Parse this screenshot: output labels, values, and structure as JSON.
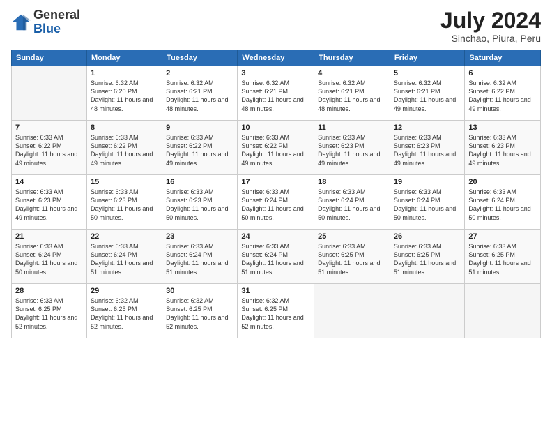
{
  "logo": {
    "general": "General",
    "blue": "Blue"
  },
  "title": {
    "month_year": "July 2024",
    "location": "Sinchao, Piura, Peru"
  },
  "weekdays": [
    "Sunday",
    "Monday",
    "Tuesday",
    "Wednesday",
    "Thursday",
    "Friday",
    "Saturday"
  ],
  "weeks": [
    [
      {
        "day": "",
        "sunrise": "",
        "sunset": "",
        "daylight": ""
      },
      {
        "day": "1",
        "sunrise": "Sunrise: 6:32 AM",
        "sunset": "Sunset: 6:20 PM",
        "daylight": "Daylight: 11 hours and 48 minutes."
      },
      {
        "day": "2",
        "sunrise": "Sunrise: 6:32 AM",
        "sunset": "Sunset: 6:21 PM",
        "daylight": "Daylight: 11 hours and 48 minutes."
      },
      {
        "day": "3",
        "sunrise": "Sunrise: 6:32 AM",
        "sunset": "Sunset: 6:21 PM",
        "daylight": "Daylight: 11 hours and 48 minutes."
      },
      {
        "day": "4",
        "sunrise": "Sunrise: 6:32 AM",
        "sunset": "Sunset: 6:21 PM",
        "daylight": "Daylight: 11 hours and 48 minutes."
      },
      {
        "day": "5",
        "sunrise": "Sunrise: 6:32 AM",
        "sunset": "Sunset: 6:21 PM",
        "daylight": "Daylight: 11 hours and 49 minutes."
      },
      {
        "day": "6",
        "sunrise": "Sunrise: 6:32 AM",
        "sunset": "Sunset: 6:22 PM",
        "daylight": "Daylight: 11 hours and 49 minutes."
      }
    ],
    [
      {
        "day": "7",
        "sunrise": "Sunrise: 6:33 AM",
        "sunset": "Sunset: 6:22 PM",
        "daylight": "Daylight: 11 hours and 49 minutes."
      },
      {
        "day": "8",
        "sunrise": "Sunrise: 6:33 AM",
        "sunset": "Sunset: 6:22 PM",
        "daylight": "Daylight: 11 hours and 49 minutes."
      },
      {
        "day": "9",
        "sunrise": "Sunrise: 6:33 AM",
        "sunset": "Sunset: 6:22 PM",
        "daylight": "Daylight: 11 hours and 49 minutes."
      },
      {
        "day": "10",
        "sunrise": "Sunrise: 6:33 AM",
        "sunset": "Sunset: 6:22 PM",
        "daylight": "Daylight: 11 hours and 49 minutes."
      },
      {
        "day": "11",
        "sunrise": "Sunrise: 6:33 AM",
        "sunset": "Sunset: 6:23 PM",
        "daylight": "Daylight: 11 hours and 49 minutes."
      },
      {
        "day": "12",
        "sunrise": "Sunrise: 6:33 AM",
        "sunset": "Sunset: 6:23 PM",
        "daylight": "Daylight: 11 hours and 49 minutes."
      },
      {
        "day": "13",
        "sunrise": "Sunrise: 6:33 AM",
        "sunset": "Sunset: 6:23 PM",
        "daylight": "Daylight: 11 hours and 49 minutes."
      }
    ],
    [
      {
        "day": "14",
        "sunrise": "Sunrise: 6:33 AM",
        "sunset": "Sunset: 6:23 PM",
        "daylight": "Daylight: 11 hours and 49 minutes."
      },
      {
        "day": "15",
        "sunrise": "Sunrise: 6:33 AM",
        "sunset": "Sunset: 6:23 PM",
        "daylight": "Daylight: 11 hours and 50 minutes."
      },
      {
        "day": "16",
        "sunrise": "Sunrise: 6:33 AM",
        "sunset": "Sunset: 6:23 PM",
        "daylight": "Daylight: 11 hours and 50 minutes."
      },
      {
        "day": "17",
        "sunrise": "Sunrise: 6:33 AM",
        "sunset": "Sunset: 6:24 PM",
        "daylight": "Daylight: 11 hours and 50 minutes."
      },
      {
        "day": "18",
        "sunrise": "Sunrise: 6:33 AM",
        "sunset": "Sunset: 6:24 PM",
        "daylight": "Daylight: 11 hours and 50 minutes."
      },
      {
        "day": "19",
        "sunrise": "Sunrise: 6:33 AM",
        "sunset": "Sunset: 6:24 PM",
        "daylight": "Daylight: 11 hours and 50 minutes."
      },
      {
        "day": "20",
        "sunrise": "Sunrise: 6:33 AM",
        "sunset": "Sunset: 6:24 PM",
        "daylight": "Daylight: 11 hours and 50 minutes."
      }
    ],
    [
      {
        "day": "21",
        "sunrise": "Sunrise: 6:33 AM",
        "sunset": "Sunset: 6:24 PM",
        "daylight": "Daylight: 11 hours and 50 minutes."
      },
      {
        "day": "22",
        "sunrise": "Sunrise: 6:33 AM",
        "sunset": "Sunset: 6:24 PM",
        "daylight": "Daylight: 11 hours and 51 minutes."
      },
      {
        "day": "23",
        "sunrise": "Sunrise: 6:33 AM",
        "sunset": "Sunset: 6:24 PM",
        "daylight": "Daylight: 11 hours and 51 minutes."
      },
      {
        "day": "24",
        "sunrise": "Sunrise: 6:33 AM",
        "sunset": "Sunset: 6:24 PM",
        "daylight": "Daylight: 11 hours and 51 minutes."
      },
      {
        "day": "25",
        "sunrise": "Sunrise: 6:33 AM",
        "sunset": "Sunset: 6:25 PM",
        "daylight": "Daylight: 11 hours and 51 minutes."
      },
      {
        "day": "26",
        "sunrise": "Sunrise: 6:33 AM",
        "sunset": "Sunset: 6:25 PM",
        "daylight": "Daylight: 11 hours and 51 minutes."
      },
      {
        "day": "27",
        "sunrise": "Sunrise: 6:33 AM",
        "sunset": "Sunset: 6:25 PM",
        "daylight": "Daylight: 11 hours and 51 minutes."
      }
    ],
    [
      {
        "day": "28",
        "sunrise": "Sunrise: 6:33 AM",
        "sunset": "Sunset: 6:25 PM",
        "daylight": "Daylight: 11 hours and 52 minutes."
      },
      {
        "day": "29",
        "sunrise": "Sunrise: 6:32 AM",
        "sunset": "Sunset: 6:25 PM",
        "daylight": "Daylight: 11 hours and 52 minutes."
      },
      {
        "day": "30",
        "sunrise": "Sunrise: 6:32 AM",
        "sunset": "Sunset: 6:25 PM",
        "daylight": "Daylight: 11 hours and 52 minutes."
      },
      {
        "day": "31",
        "sunrise": "Sunrise: 6:32 AM",
        "sunset": "Sunset: 6:25 PM",
        "daylight": "Daylight: 11 hours and 52 minutes."
      },
      {
        "day": "",
        "sunrise": "",
        "sunset": "",
        "daylight": ""
      },
      {
        "day": "",
        "sunrise": "",
        "sunset": "",
        "daylight": ""
      },
      {
        "day": "",
        "sunrise": "",
        "sunset": "",
        "daylight": ""
      }
    ]
  ]
}
